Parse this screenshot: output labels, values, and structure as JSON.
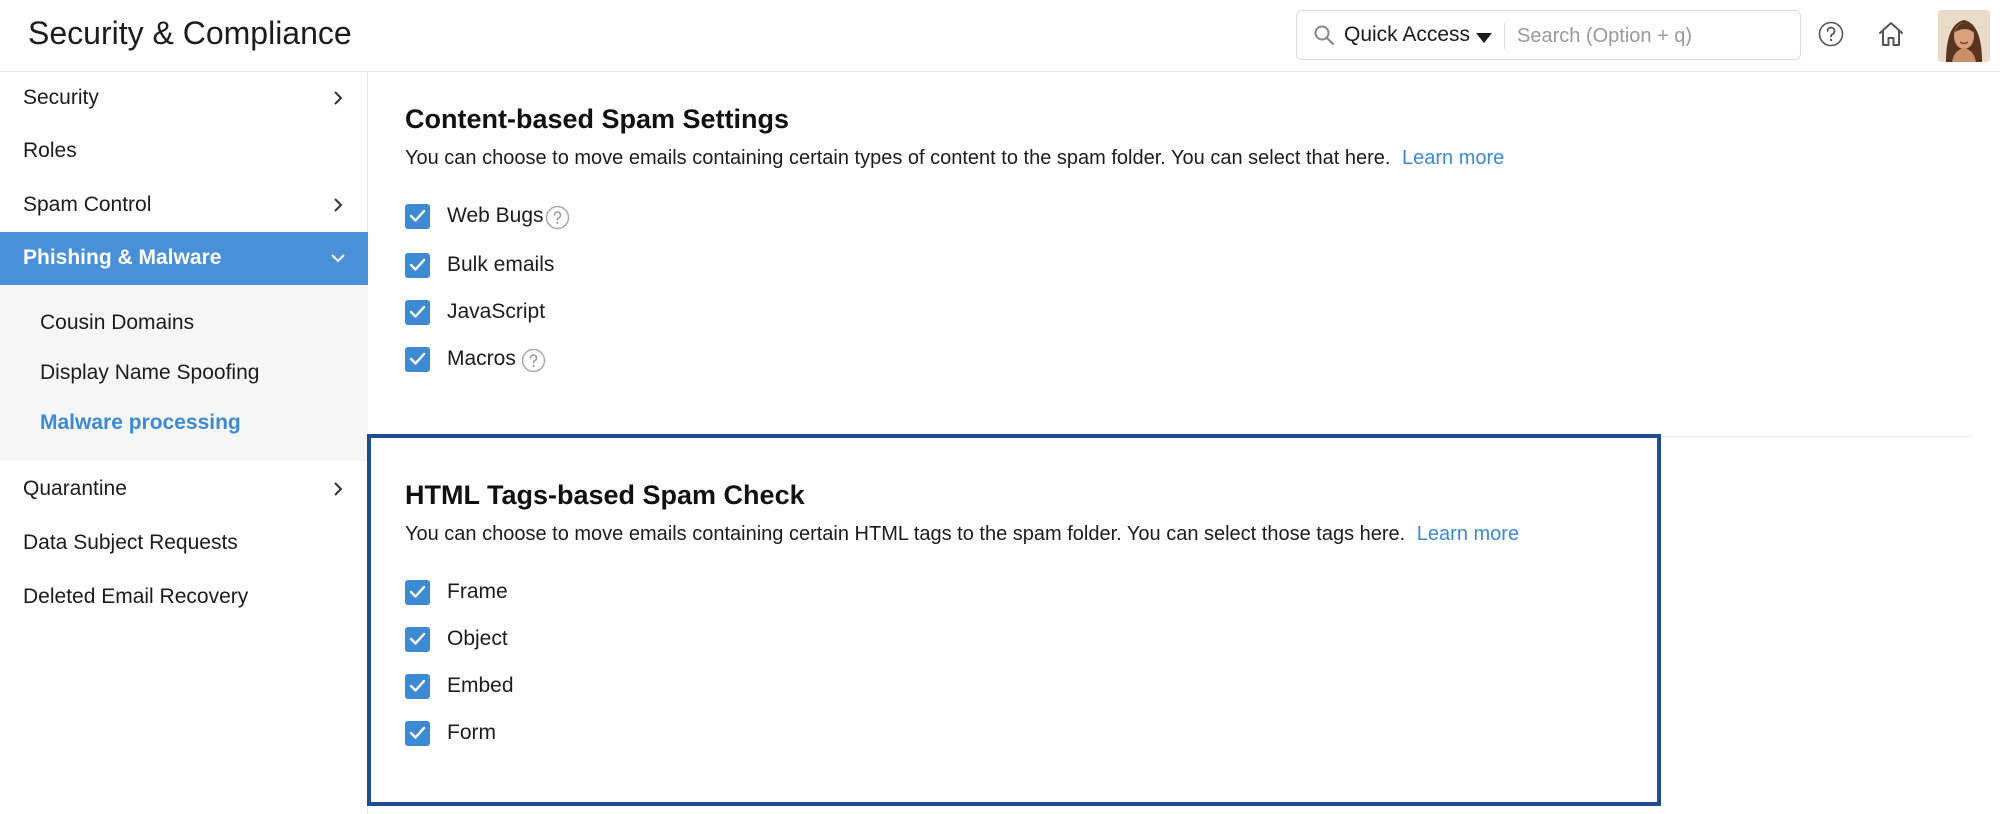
{
  "header": {
    "title": "Security & Compliance",
    "quick_access_label": "Quick Access",
    "search_placeholder": "Search (Option + q)"
  },
  "sidebar": {
    "items": [
      {
        "label": "Security",
        "has_submenu": true
      },
      {
        "label": "Roles",
        "has_submenu": false
      },
      {
        "label": "Spam Control",
        "has_submenu": true
      },
      {
        "label": "Phishing & Malware",
        "has_submenu": true,
        "expanded": true
      },
      {
        "label": "Quarantine",
        "has_submenu": true
      },
      {
        "label": "Data Subject Requests",
        "has_submenu": false
      },
      {
        "label": "Deleted Email Recovery",
        "has_submenu": false
      }
    ],
    "subitems": [
      {
        "label": "Cousin Domains"
      },
      {
        "label": "Display Name Spoofing"
      },
      {
        "label": "Malware processing",
        "active": true
      }
    ]
  },
  "content_spam": {
    "title": "Content-based Spam Settings",
    "description": "You can choose to move emails containing certain types of content to the spam folder. You can select that here.",
    "learn_more": "Learn more",
    "options": [
      {
        "label": "Web Bugs",
        "checked": true,
        "has_help": true
      },
      {
        "label": "Bulk emails",
        "checked": true,
        "has_help": false
      },
      {
        "label": "JavaScript",
        "checked": true,
        "has_help": false
      },
      {
        "label": "Macros",
        "checked": true,
        "has_help": true
      }
    ]
  },
  "html_tags": {
    "title": "HTML Tags-based Spam Check",
    "description": "You can choose to move emails containing certain HTML tags to the spam folder. You can select those tags here.",
    "learn_more": "Learn more",
    "options": [
      {
        "label": "Frame",
        "checked": true
      },
      {
        "label": "Object",
        "checked": true
      },
      {
        "label": "Embed",
        "checked": true
      },
      {
        "label": "Form",
        "checked": true
      }
    ]
  },
  "colors": {
    "accent": "#3d8ad4",
    "active_nav": "#4a90d9",
    "highlight_border": "#1f4e8c"
  }
}
